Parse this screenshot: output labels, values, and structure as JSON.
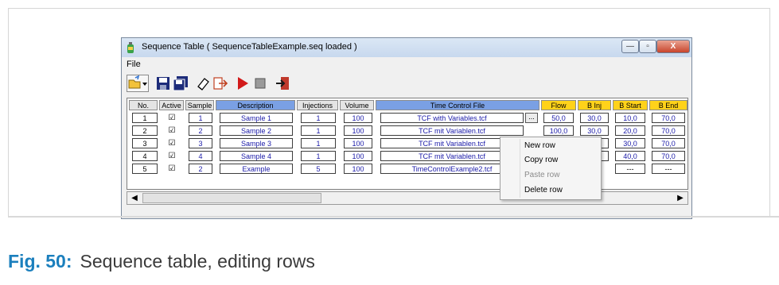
{
  "window": {
    "title": "Sequence Table ( SequenceTableExample.seq loaded )",
    "controls": {
      "minimize": "—",
      "maximize": "▫",
      "close": "X"
    }
  },
  "menu": {
    "file": "File"
  },
  "toolbar": {
    "icons": [
      "open-folder-icon",
      "dropdown-arrow-icon",
      "save-icon",
      "save-all-icon",
      "eraser-icon",
      "export-icon",
      "run-icon",
      "stop-icon",
      "exit-icon"
    ]
  },
  "table": {
    "headers": [
      "No.",
      "Active",
      "Sample",
      "Description",
      "Injections",
      "Volume",
      "Time Control File",
      "Flow",
      "B Inj",
      "B Start",
      "B End"
    ],
    "rows": [
      {
        "no": "1",
        "active": "☑",
        "sample": "1",
        "description": "Sample 1",
        "injections": "1",
        "volume": "100",
        "tcf": "TCF with Variables.tcf",
        "flow": "50,0",
        "b_inj": "30,0",
        "b_start": "10,0",
        "b_end": "70,0"
      },
      {
        "no": "2",
        "active": "☑",
        "sample": "2",
        "description": "Sample 2",
        "injections": "1",
        "volume": "100",
        "tcf": "TCF mit Variablen.tcf",
        "flow": "100,0",
        "b_inj": "30,0",
        "b_start": "20,0",
        "b_end": "70,0"
      },
      {
        "no": "3",
        "active": "☑",
        "sample": "3",
        "description": "Sample 3",
        "injections": "1",
        "volume": "100",
        "tcf": "TCF mit Variablen.tcf",
        "flow": "",
        "b_inj": "0",
        "b_start": "30,0",
        "b_end": "70,0"
      },
      {
        "no": "4",
        "active": "☑",
        "sample": "4",
        "description": "Sample 4",
        "injections": "1",
        "volume": "100",
        "tcf": "TCF mit Variablen.tcf",
        "flow": "",
        "b_inj": "0",
        "b_start": "40,0",
        "b_end": "70,0"
      },
      {
        "no": "5",
        "active": "☑",
        "sample": "2",
        "description": "Example",
        "injections": "5",
        "volume": "100",
        "tcf": "TimeControlExample2.tcf",
        "flow": "",
        "b_inj": "",
        "b_start": "---",
        "b_end": "---"
      }
    ],
    "ellipsis": "..."
  },
  "scrollbar": {
    "left": "◀",
    "right": "▶"
  },
  "context_menu": {
    "items": [
      {
        "label": "New row",
        "enabled": true
      },
      {
        "label": "Copy row",
        "enabled": true
      },
      {
        "label": "Paste row",
        "enabled": false
      },
      {
        "label": "Delete row",
        "enabled": true
      }
    ]
  },
  "caption": {
    "number": "Fig. 50:",
    "text": "Sequence table, editing rows"
  },
  "colors": {
    "header_blue": "#7aa0e4",
    "header_yellow": "#ffd21a",
    "caption_blue": "#1b7fbd",
    "cell_text": "#1a1aa8"
  }
}
